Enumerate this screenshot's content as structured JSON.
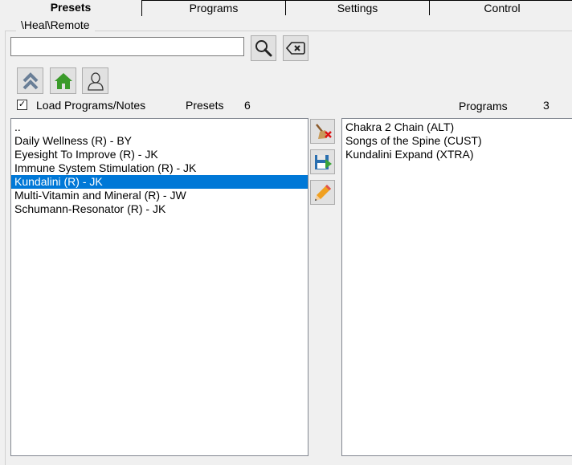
{
  "tabs": [
    {
      "label": "Presets",
      "active": true
    },
    {
      "label": "Programs",
      "active": false
    },
    {
      "label": "Settings",
      "active": false
    },
    {
      "label": "Control",
      "active": false
    }
  ],
  "group": {
    "title": "\\Heal\\Remote"
  },
  "search": {
    "value": "",
    "placeholder": ""
  },
  "icons": {
    "search": "search-icon",
    "clear": "backspace-icon",
    "up": "double-chevron-up-icon",
    "home": "home-icon",
    "user": "user-icon",
    "delete": "broom-delete-icon",
    "save": "save-icon",
    "edit": "pencil-icon"
  },
  "load_checkbox": {
    "checked": true,
    "label": "Load Programs/Notes"
  },
  "presets": {
    "label": "Presets",
    "count": "6",
    "items": [
      "..",
      "Daily Wellness (R) - BY",
      "Eyesight To Improve (R) - JK",
      "Immune System Stimulation (R) - JK",
      "Kundalini (R) - JK",
      "Multi-Vitamin and Mineral (R) - JW",
      "Schumann-Resonator (R) - JK"
    ],
    "selected_index": 4
  },
  "programs": {
    "label": "Programs",
    "count": "3",
    "items": [
      "Chakra 2 Chain (ALT)",
      "Songs of the Spine (CUST)",
      "Kundalini Expand (XTRA)"
    ]
  },
  "colors": {
    "selection": "#0078d7",
    "home_green": "#3a9a2a"
  }
}
